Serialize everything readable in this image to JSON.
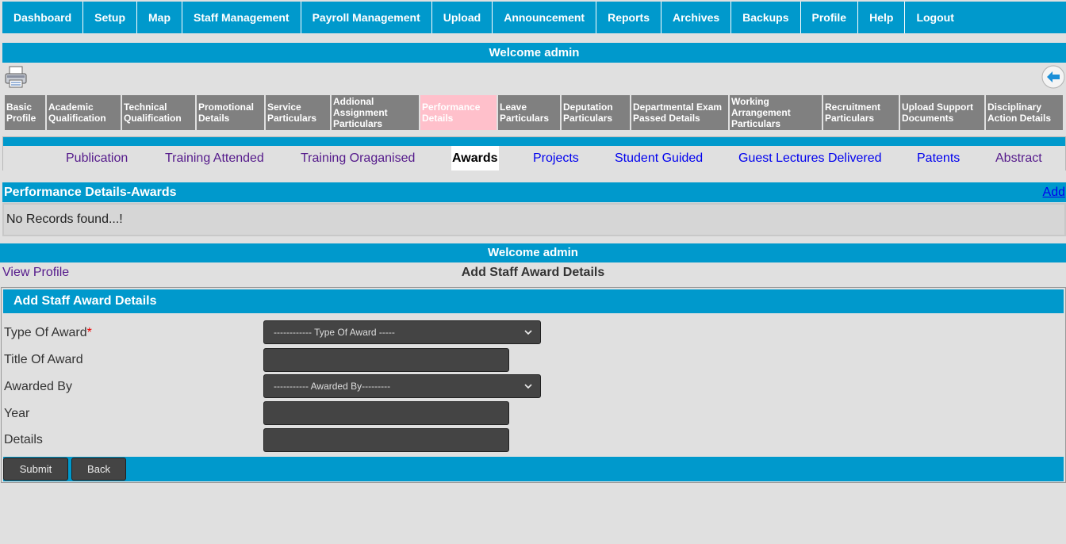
{
  "topnav": [
    "Dashboard",
    "Setup",
    "Map",
    "Staff Management",
    "Payroll Management",
    "Upload",
    "Announcement",
    "Reports",
    "Archives",
    "Backups",
    "Profile",
    "Help",
    "Logout"
  ],
  "welcome": "Welcome admin",
  "section_tabs": [
    {
      "label": "Basic Profile",
      "active": false
    },
    {
      "label": "Academic Qualification",
      "active": false
    },
    {
      "label": "Technical Qualification",
      "active": false
    },
    {
      "label": "Promotional Details",
      "active": false
    },
    {
      "label": "Service Particulars",
      "active": false
    },
    {
      "label": "Addional Assignment Particulars",
      "active": false
    },
    {
      "label": "Performance Details",
      "active": true
    },
    {
      "label": "Leave Particulars",
      "active": false
    },
    {
      "label": "Deputation Particulars",
      "active": false
    },
    {
      "label": "Departmental Exam Passed Details",
      "active": false
    },
    {
      "label": "Working Arrangement Particulars",
      "active": false
    },
    {
      "label": "Recruitment Particulars",
      "active": false
    },
    {
      "label": "Upload Support Documents",
      "active": false
    },
    {
      "label": "Disciplinary Action Details",
      "active": false
    }
  ],
  "sub_tabs": [
    {
      "label": "Publication",
      "state": "visited"
    },
    {
      "label": "Training Attended",
      "state": "visited"
    },
    {
      "label": "Training Oraganised",
      "state": "visited"
    },
    {
      "label": "Awards",
      "state": "active"
    },
    {
      "label": "Projects",
      "state": "link"
    },
    {
      "label": "Student Guided",
      "state": "link"
    },
    {
      "label": "Guest Lectures Delivered",
      "state": "link"
    },
    {
      "label": "Patents",
      "state": "link"
    },
    {
      "label": "Abstract",
      "state": "visited"
    }
  ],
  "performance": {
    "title": "Performance Details-Awards",
    "add_label": "Add",
    "empty_message": "No Records found...!"
  },
  "welcome2": "Welcome admin",
  "view_profile": "View Profile",
  "page_title": "Add Staff Award Details",
  "form": {
    "title": "Add Staff Award Details",
    "required_mark": "*",
    "type_of_award": {
      "label": "Type Of Award",
      "value": "------------ Type Of Award -----"
    },
    "title_of_award": {
      "label": "Title Of Award",
      "value": ""
    },
    "awarded_by": {
      "label": "Awarded By",
      "value": "----------- Awarded By---------"
    },
    "year": {
      "label": "Year",
      "value": ""
    },
    "details": {
      "label": "Details",
      "value": ""
    },
    "submit_label": "Submit",
    "back_label": "Back"
  },
  "colors": {
    "primary": "#0099cc",
    "tab_gray": "#808080",
    "tab_active": "#ffc0cb",
    "field_bg": "#444444"
  },
  "icons": {
    "print": "printer-icon",
    "back": "back-arrow-icon",
    "dropdown": "chevron-down-icon"
  }
}
